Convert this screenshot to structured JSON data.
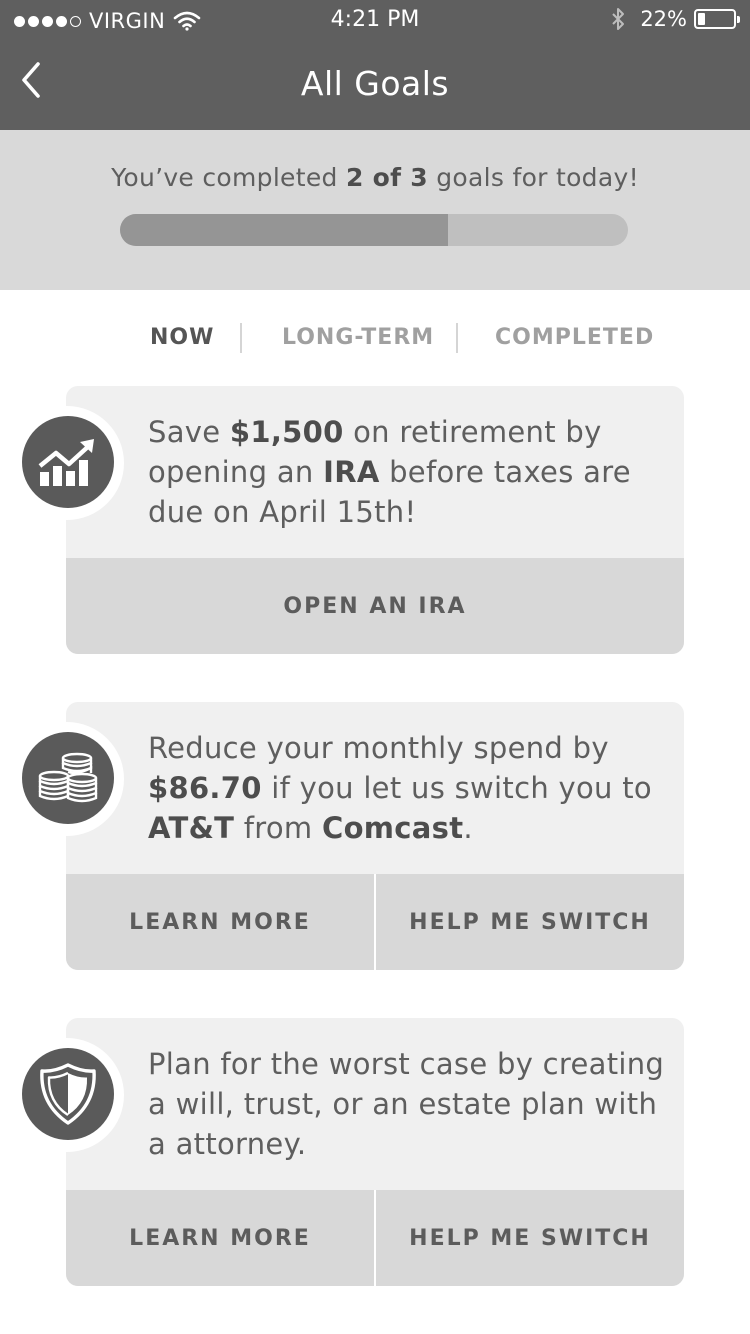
{
  "status_bar": {
    "carrier": "VIRGIN",
    "time": "4:21 PM",
    "battery_percent_text": "22%",
    "battery_level": 0.22,
    "signal_bars_filled": 4,
    "signal_bars_total": 5
  },
  "nav": {
    "title": "All Goals",
    "back_icon": "chevron-left-icon"
  },
  "progress": {
    "prefix": "You’ve completed ",
    "count": "2 of 3",
    "suffix": " goals for today!",
    "fraction": 0.6457
  },
  "tabs": [
    {
      "label": "NOW",
      "active": true
    },
    {
      "label": "LONG-TERM",
      "active": false
    },
    {
      "label": "COMPLETED",
      "active": false
    }
  ],
  "goals": [
    {
      "icon": "growth-chart-icon",
      "text": [
        {
          "t": "Save ",
          "bold": false
        },
        {
          "t": "$1,500",
          "bold": true
        },
        {
          "t": " on retirement by opening an ",
          "bold": false
        },
        {
          "t": "IRA",
          "bold": true
        },
        {
          "t": " before taxes are due on April 15th!",
          "bold": false
        }
      ],
      "actions": [
        "OPEN AN IRA"
      ]
    },
    {
      "icon": "coins-icon",
      "text": [
        {
          "t": "Reduce your monthly spend by ",
          "bold": false
        },
        {
          "t": "$86.70",
          "bold": true
        },
        {
          "t": " if you let us switch you to ",
          "bold": false
        },
        {
          "t": "AT&T",
          "bold": true
        },
        {
          "t": " from ",
          "bold": false
        },
        {
          "t": "Comcast",
          "bold": true
        },
        {
          "t": ".",
          "bold": false
        }
      ],
      "actions": [
        "LEARN MORE",
        "HELP ME SWITCH"
      ]
    },
    {
      "icon": "shield-icon",
      "text": [
        {
          "t": "Plan for the worst case by creating a will, trust, or an estate plan with a attorney.",
          "bold": false
        }
      ],
      "actions": [
        "LEARN MORE",
        "HELP ME SWITCH"
      ]
    }
  ],
  "colors": {
    "header_bg": "#5f5f5f",
    "progress_bg": "#d9d9d9",
    "progress_fill": "#959595",
    "progress_track": "#bfbfbf",
    "card_bg": "#f0f0f0",
    "action_bg": "#d8d8d8",
    "icon_bg": "#5a5a5a"
  }
}
